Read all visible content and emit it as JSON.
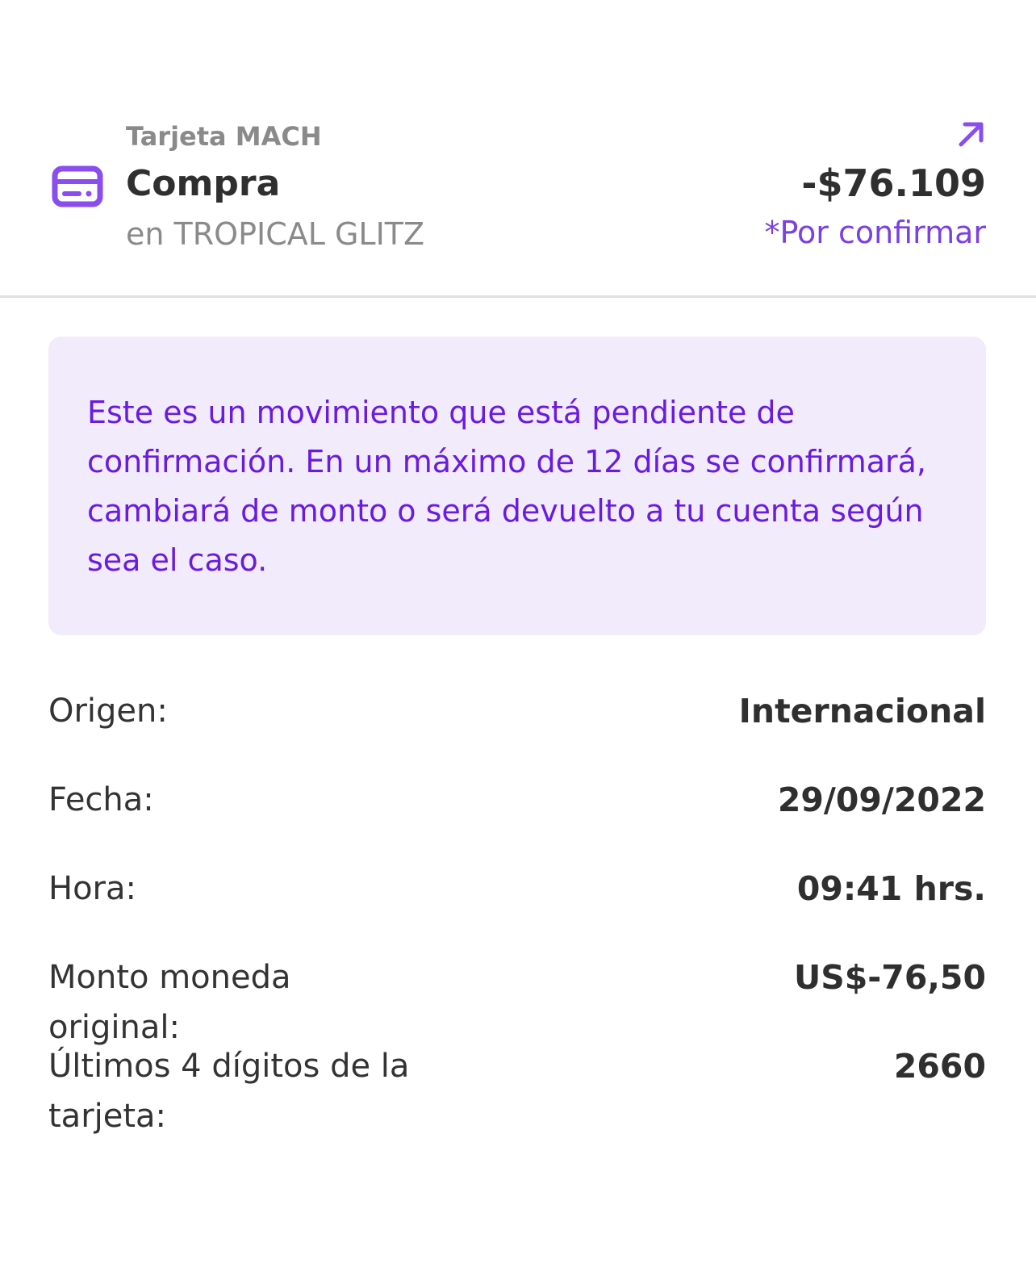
{
  "header": {
    "subtitle": "Tarjeta MACH",
    "title": "Compra",
    "merchant": "en TROPICAL GLITZ",
    "amount": "-$76.109",
    "status": "*Por confirmar",
    "card_icon": "credit-card-icon",
    "arrow_icon": "arrow-up-right-icon"
  },
  "notice": {
    "text": "Este es un movimiento que está pendiente de confirmación. En un máximo de 12 días se confirmará, cambiará de monto o será devuelto a tu cuenta según sea el caso."
  },
  "details": [
    {
      "label": "Origen:",
      "value": "Internacional"
    },
    {
      "label": "Fecha:",
      "value": "29/09/2022"
    },
    {
      "label": "Hora:",
      "value": "09:41 hrs."
    },
    {
      "label": "Monto moneda original:",
      "value": "US$-76,50"
    },
    {
      "label": "Últimos 4 dígitos de la tarjeta:",
      "value": "2660"
    }
  ],
  "colors": {
    "accent": "#7b3fe4",
    "notice_bg": "#f1ebfc",
    "notice_text": "#6a1be0"
  }
}
